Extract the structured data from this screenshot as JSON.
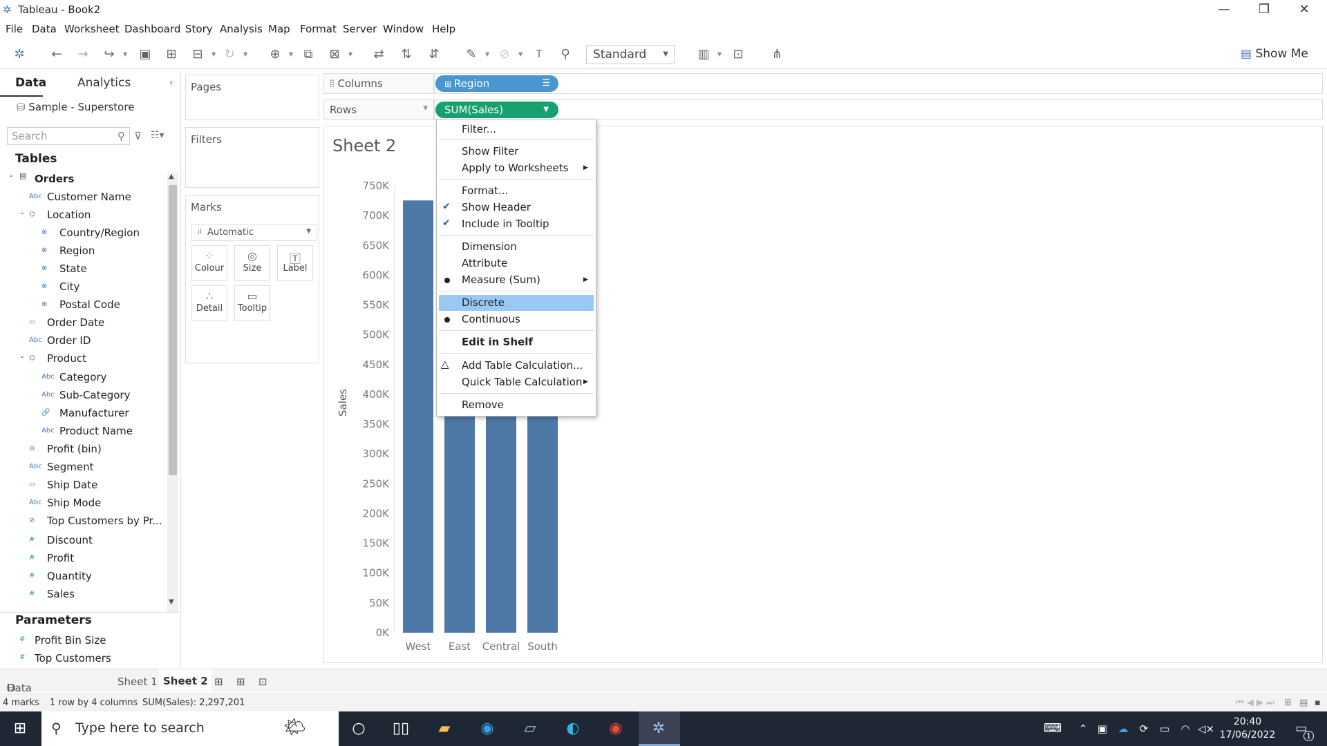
{
  "window": {
    "title": "Tableau - Book2",
    "minimize": "—",
    "restore": "❐",
    "close": "✕"
  },
  "menu": [
    "File",
    "Data",
    "Worksheet",
    "Dashboard",
    "Story",
    "Analysis",
    "Map",
    "Format",
    "Server",
    "Window",
    "Help"
  ],
  "toolbar": {
    "fit_mode": "Standard",
    "show_me": "Show Me"
  },
  "data_pane": {
    "tabs": [
      "Data",
      "Analytics"
    ],
    "datasource": "Sample - Superstore",
    "search_placeholder": "Search",
    "tables_header": "Tables",
    "table_name": "Orders",
    "fields": [
      {
        "icon": "Abc",
        "name": "Customer Name"
      },
      {
        "icon": "⌬",
        "name": "Location"
      },
      {
        "icon": "⊕",
        "name": "Country/Region"
      },
      {
        "icon": "⊕",
        "name": "Region"
      },
      {
        "icon": "⊕",
        "name": "State"
      },
      {
        "icon": "⊕",
        "name": "City"
      },
      {
        "icon": "⊕",
        "name": "Postal Code"
      },
      {
        "icon": "▭",
        "name": "Order Date"
      },
      {
        "icon": "Abc",
        "name": "Order ID"
      },
      {
        "icon": "⌬",
        "name": "Product"
      },
      {
        "icon": "Abc",
        "name": "Category"
      },
      {
        "icon": "Abc",
        "name": "Sub-Category"
      },
      {
        "icon": "🔗",
        "name": "Manufacturer"
      },
      {
        "icon": "Abc",
        "name": "Product Name"
      },
      {
        "icon": "ılı",
        "name": "Profit (bin)"
      },
      {
        "icon": "Abc",
        "name": "Segment"
      },
      {
        "icon": "▭",
        "name": "Ship Date"
      },
      {
        "icon": "Abc",
        "name": "Ship Mode"
      },
      {
        "icon": "⊘",
        "name": "Top Customers by Pr..."
      },
      {
        "icon": "#",
        "name": "Discount"
      },
      {
        "icon": "#",
        "name": "Profit"
      },
      {
        "icon": "#",
        "name": "Quantity"
      },
      {
        "icon": "#",
        "name": "Sales"
      }
    ],
    "parameters_header": "Parameters",
    "parameters": [
      {
        "icon": "#",
        "name": "Profit Bin Size"
      },
      {
        "icon": "#",
        "name": "Top Customers"
      }
    ]
  },
  "cards": {
    "pages": "Pages",
    "filters": "Filters",
    "marks": "Marks",
    "mark_type": "Automatic",
    "mark_buttons": [
      "Colour",
      "Size",
      "Label",
      "Detail",
      "Tooltip"
    ]
  },
  "shelves": {
    "columns_label": "Columns",
    "rows_label": "Rows",
    "columns_pill": "Region",
    "rows_pill": "SUM(Sales)"
  },
  "sheet": {
    "title": "Sheet 2"
  },
  "chart_data": {
    "type": "bar",
    "categories": [
      "West",
      "East",
      "Central",
      "South"
    ],
    "values": [
      725458,
      678781,
      501240,
      391722
    ],
    "ylabel": "Sales",
    "ylim": [
      0,
      750000
    ],
    "yticks": [
      "0K",
      "50K",
      "100K",
      "150K",
      "200K",
      "250K",
      "300K",
      "350K",
      "400K",
      "450K",
      "500K",
      "550K",
      "600K",
      "650K",
      "700K",
      "750K"
    ],
    "bar_color": "#4e79a7",
    "grid": false
  },
  "context_menu": {
    "items": [
      {
        "label": "Filter..."
      },
      {
        "label": "Show Filter"
      },
      {
        "label": "Apply to Worksheets",
        "submenu": true
      },
      {
        "label": "Format..."
      },
      {
        "label": "Show Header",
        "checked": true
      },
      {
        "label": "Include in Tooltip",
        "checked": true
      },
      {
        "label": "Dimension"
      },
      {
        "label": "Attribute"
      },
      {
        "label": "Measure (Sum)",
        "selected": true,
        "submenu": true
      },
      {
        "label": "Discrete",
        "highlighted": true
      },
      {
        "label": "Continuous",
        "selected": true
      },
      {
        "label": "Edit in Shelf",
        "bold": true
      },
      {
        "label": "Add Table Calculation..."
      },
      {
        "label": "Quick Table Calculation",
        "submenu": true
      },
      {
        "label": "Remove"
      }
    ]
  },
  "bottom_tabs": {
    "datasource": "Data Source",
    "sheets": [
      "Sheet 1",
      "Sheet 2"
    ],
    "active": "Sheet 2"
  },
  "status": {
    "marks": "4 marks",
    "dims": "1 row by 4 columns",
    "sum": "SUM(Sales): 2,297,201"
  },
  "taskbar": {
    "search_placeholder": "Type here to search",
    "time": "20:40",
    "date": "17/06/2022",
    "notifications": "1"
  },
  "colors": {
    "dimension_pill": "#4996d1",
    "measure_pill": "#18a06e",
    "menu_highlight": "#99c9f3"
  }
}
